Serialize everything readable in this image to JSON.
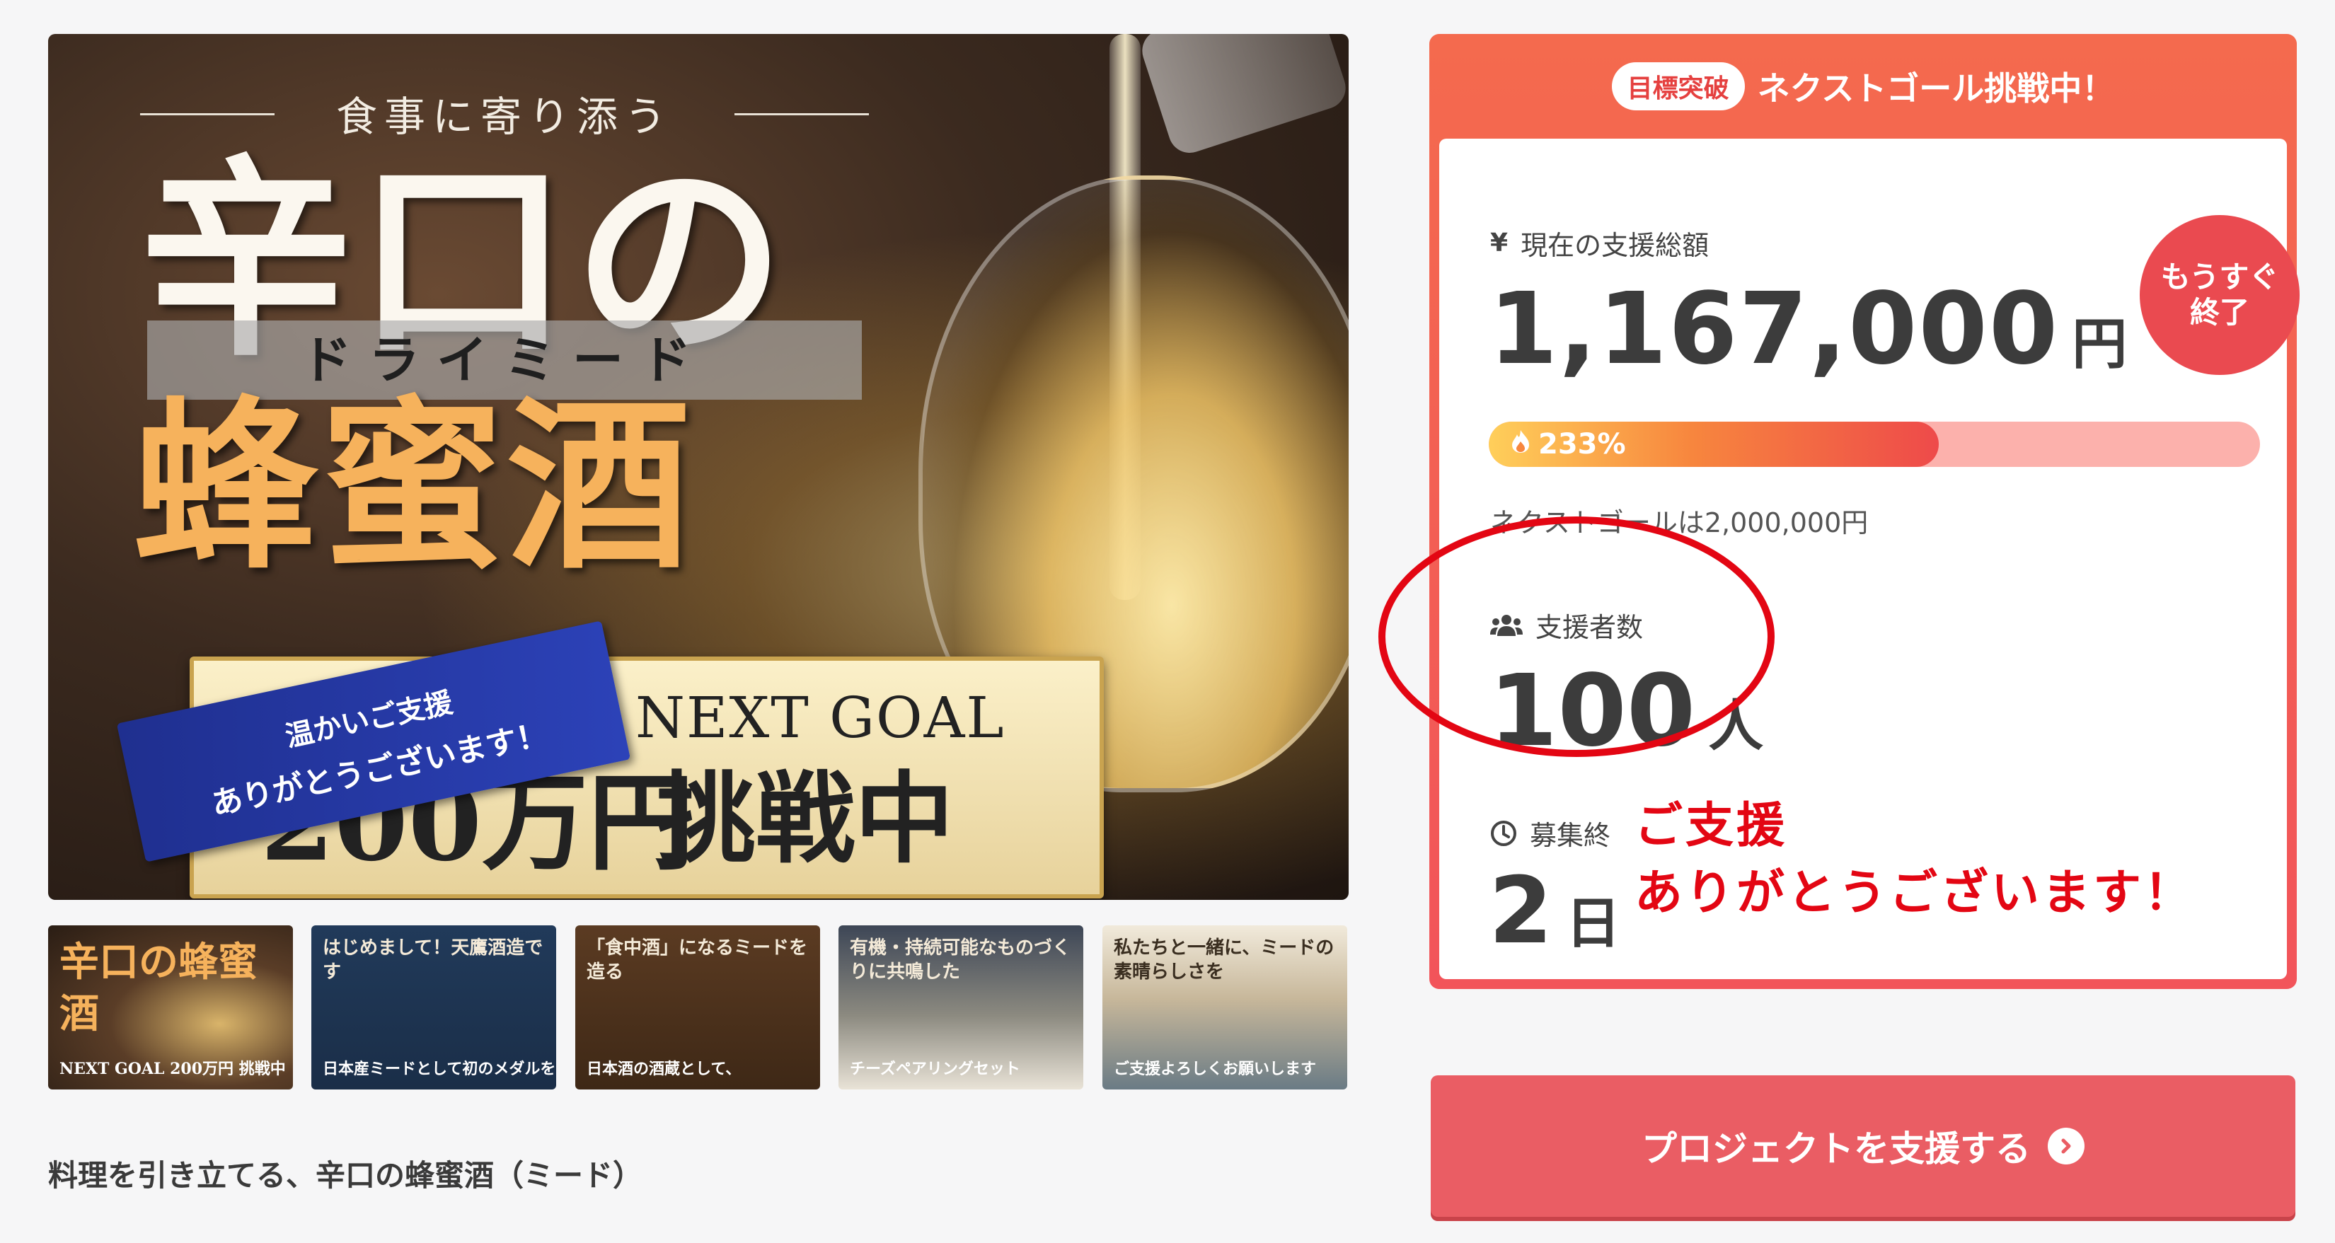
{
  "hero": {
    "tagline": "食事に寄り添う",
    "title_top": "辛口の",
    "title_ruby": "ドライミード",
    "title_main": "蜂蜜酒",
    "ribbon_line1": "温かいご支援",
    "ribbon_line2": "ありがとうございます！",
    "next_goal": "NEXT GOAL",
    "goal_amount": "200万円",
    "challenge": "挑戦中"
  },
  "thumbnails": [
    {
      "top": "辛口の蜂蜜酒",
      "bottom": "NEXT GOAL 200万円 挑戦中"
    },
    {
      "top": "はじめまして！天鷹酒造です",
      "bottom": "日本産ミードとして初のメダルを"
    },
    {
      "top": "「食中酒」になるミードを造る",
      "bottom": "日本酒の酒蔵として、"
    },
    {
      "top": "有機・持続可能なものづくりに共鳴した",
      "bottom": "チーズペアリングセット"
    },
    {
      "top": "私たちと一緒に、ミードの素晴らしさを",
      "bottom": "ご支援よろしくお願いします"
    }
  ],
  "caption": "料理を引き立てる、辛口の蜂蜜酒（ミード）",
  "panel": {
    "badge": "目標突破",
    "header": "ネクストゴール挑戦中！",
    "total_label": "現在の支援総額",
    "total_amount": "1,167,000",
    "total_unit": "円",
    "soon_line1": "もうすぐ",
    "soon_line2": "終了",
    "progress_percent": 233,
    "progress_label": "233%",
    "next_goal_text": "ネクストゴールは2,000,000円",
    "supporters_label": "支援者数",
    "supporters_count": "100",
    "supporters_unit": "人",
    "days_label": "募集終",
    "days_count": "2",
    "days_unit": "日"
  },
  "annotation": {
    "line1": "ご支援",
    "line2": "ありがとうございます！",
    "color": "#e30613"
  },
  "support_button": {
    "label": "プロジェクトを支援する"
  },
  "colors": {
    "accent": "#ea5d64",
    "panel_gradient_start": "#f46a4e",
    "progress_track": "#fcb1ac"
  },
  "icons": {
    "yen": "yen-icon",
    "people": "people-icon",
    "clock": "clock-icon",
    "flame": "flame-icon",
    "arrow": "arrow-right-circle-icon"
  }
}
